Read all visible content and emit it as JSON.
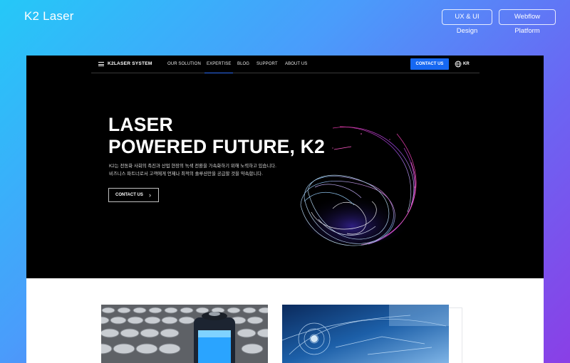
{
  "showcase": {
    "title": "K2 Laser",
    "tags": [
      "UX & UI Design",
      "Webflow Platform"
    ]
  },
  "site": {
    "brand": "K2LASER SYSTEM",
    "nav": [
      "OUR SOLUTION",
      "EXPERTISE",
      "BLOG",
      "SUPPORT",
      "ABOUT US"
    ],
    "active_nav": "EXPERTISE",
    "contact_button": "CONTACT US",
    "language": "KR",
    "hero": {
      "headline_line1": "LASER",
      "headline_line2": "POWERED FUTURE, K2",
      "desc_line1": "K2는 전동화 사회의 촉진과 산업 현장의 녹색 전환을 가속화하기 위해 노력하고 있습니다.",
      "desc_line2": "비즈니스 파트너로서 고객에게 언제나 최적의 솔루션만을 공급할 것을 약속합니다.",
      "cta_label": "CONTACT US"
    }
  },
  "colors": {
    "accent": "#1668f2",
    "hero_bg": "#000000",
    "gradient_start": "#25c8f8",
    "gradient_end": "#8a3fe6"
  },
  "icons": [
    "menu-icon",
    "globe-icon",
    "chevron-right-icon"
  ]
}
